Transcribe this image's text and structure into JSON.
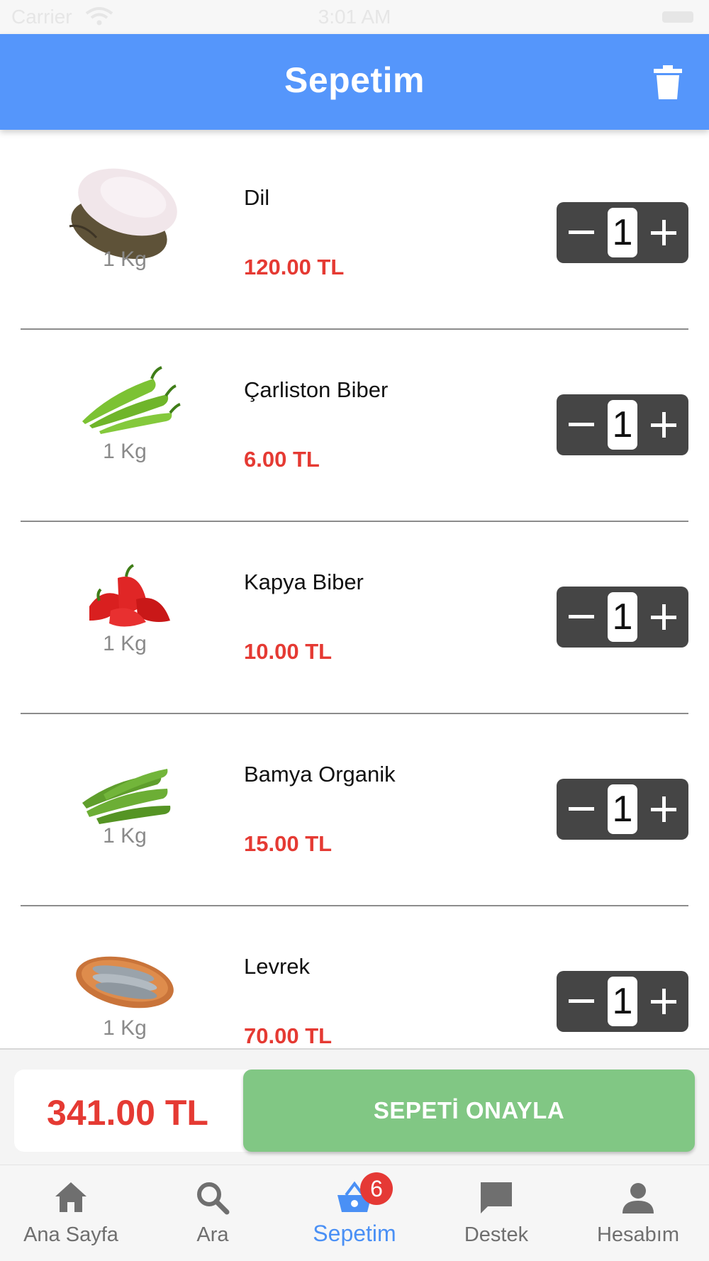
{
  "status_bar": {
    "carrier": "Carrier",
    "time": "3:01 AM"
  },
  "header": {
    "title": "Sepetim",
    "trash_icon": "trash-icon"
  },
  "cart": {
    "items": [
      {
        "name": "Dil",
        "unit": "1 Kg",
        "price": "120.00 TL",
        "quantity": "1",
        "image": "flatfish-image"
      },
      {
        "name": "Çarliston Biber",
        "unit": "1 Kg",
        "price": "6.00 TL",
        "quantity": "1",
        "image": "green-pepper-image"
      },
      {
        "name": "Kapya Biber",
        "unit": "1 Kg",
        "price": "10.00 TL",
        "quantity": "1",
        "image": "red-pepper-image"
      },
      {
        "name": "Bamya Organik",
        "unit": "1 Kg",
        "price": "15.00 TL",
        "quantity": "1",
        "image": "okra-image"
      },
      {
        "name": "Levrek",
        "unit": "1 Kg",
        "price": "70.00 TL",
        "quantity": "1",
        "image": "sea-bass-image"
      }
    ]
  },
  "checkout": {
    "total": "341.00 TL",
    "confirm_label": "SEPETİ ONAYLA"
  },
  "bottom_nav": {
    "items": [
      {
        "label": "Ana Sayfa",
        "icon": "home-icon"
      },
      {
        "label": "Ara",
        "icon": "search-icon"
      },
      {
        "label": "Sepetim",
        "icon": "basket-icon",
        "active": true,
        "badge": "6"
      },
      {
        "label": "Destek",
        "icon": "chat-icon"
      },
      {
        "label": "Hesabım",
        "icon": "person-icon"
      }
    ]
  },
  "colors": {
    "app_bar": "#5596fb",
    "price": "#e53a33",
    "stepper": "#454545",
    "confirm": "#81c784",
    "active_tab": "#4a90f5",
    "badge": "#e53935"
  }
}
